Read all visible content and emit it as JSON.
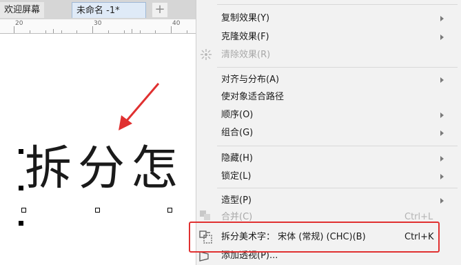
{
  "tabs": {
    "welcome": "欢迎屏幕",
    "untitled": "未命名 -1*",
    "add": "+"
  },
  "ruler": {
    "marks": [
      "20",
      "30",
      "40"
    ]
  },
  "canvas": {
    "text": "拆分怎"
  },
  "menu": {
    "copy_effect": "复制效果(Y)",
    "clone_effect": "克隆效果(F)",
    "clear_effect": "清除效果(R)",
    "align_distribute": "对齐与分布(A)",
    "fit_path": "使对象适合路径",
    "order": "顺序(O)",
    "group": "组合(G)",
    "hide": "隐藏(H)",
    "lock": "锁定(L)",
    "shaping": "造型(P)",
    "combine": "合并(C)",
    "combine_shortcut": "Ctrl+L",
    "break_art_text": "拆分美术字： 宋体 (常规) (CHC)(B)",
    "break_shortcut": "Ctrl+K",
    "add_perspective": "添加透视(P)..."
  },
  "colors": {
    "highlight": "#e03030",
    "annotation_arrow": "#e03030"
  }
}
